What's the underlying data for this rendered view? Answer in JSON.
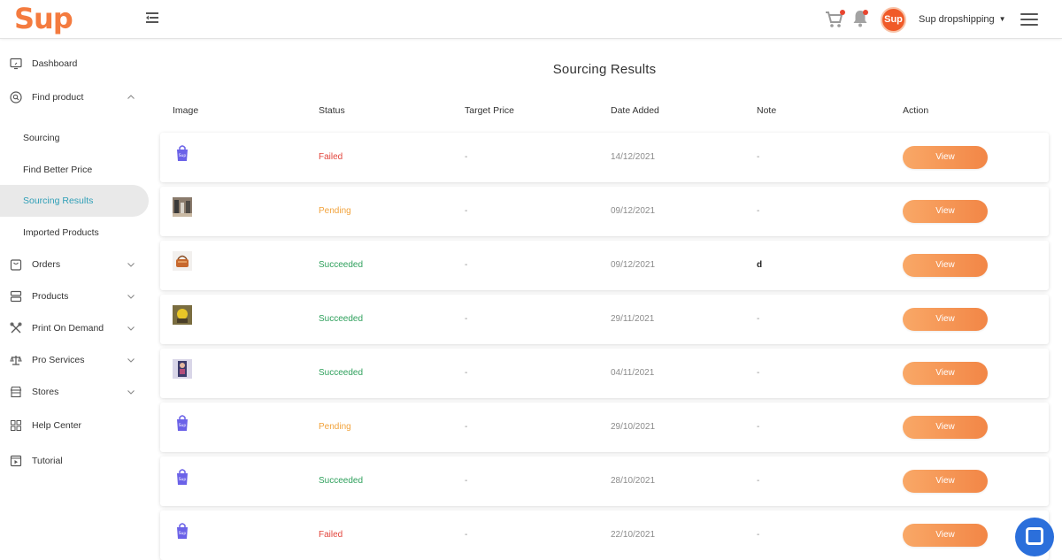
{
  "header": {
    "logo": "Sup",
    "avatar_text": "Sup",
    "account_name": "Sup dropshipping"
  },
  "sidebar": {
    "items": [
      {
        "label": "Dashboard",
        "icon": "monitor-icon"
      },
      {
        "label": "Find product",
        "icon": "search-circle-icon",
        "expanded": true
      },
      {
        "label": "Orders",
        "icon": "bag-icon"
      },
      {
        "label": "Products",
        "icon": "stack-icon"
      },
      {
        "label": "Print On Demand",
        "icon": "tools-icon"
      },
      {
        "label": "Pro Services",
        "icon": "scale-icon"
      },
      {
        "label": "Stores",
        "icon": "store-icon"
      },
      {
        "label": "Help Center",
        "icon": "grid-icon"
      },
      {
        "label": "Tutorial",
        "icon": "play-icon"
      }
    ],
    "sub_items": [
      {
        "label": "Sourcing"
      },
      {
        "label": "Find Better Price"
      },
      {
        "label": "Sourcing Results",
        "active": true
      },
      {
        "label": "Imported Products"
      }
    ]
  },
  "main": {
    "title": "Sourcing Results",
    "columns": [
      "Image",
      "Status",
      "Target Price",
      "Date Added",
      "Note",
      "Action"
    ],
    "rows": [
      {
        "image": "sup-bag",
        "status": "Failed",
        "target_price": "-",
        "date_added": "14/12/2021",
        "note": "-",
        "action": "View"
      },
      {
        "image": "photo-people",
        "status": "Pending",
        "target_price": "-",
        "date_added": "09/12/2021",
        "note": "-",
        "action": "View"
      },
      {
        "image": "photo-basket",
        "status": "Succeeded",
        "target_price": "-",
        "date_added": "09/12/2021",
        "note": "d",
        "action": "View"
      },
      {
        "image": "photo-yellow",
        "status": "Succeeded",
        "target_price": "-",
        "date_added": "29/11/2021",
        "note": "-",
        "action": "View"
      },
      {
        "image": "photo-figure",
        "status": "Succeeded",
        "target_price": "-",
        "date_added": "04/11/2021",
        "note": "-",
        "action": "View"
      },
      {
        "image": "sup-bag",
        "status": "Pending",
        "target_price": "-",
        "date_added": "29/10/2021",
        "note": "-",
        "action": "View"
      },
      {
        "image": "sup-bag",
        "status": "Succeeded",
        "target_price": "-",
        "date_added": "28/10/2021",
        "note": "-",
        "action": "View"
      },
      {
        "image": "sup-bag",
        "status": "Failed",
        "target_price": "-",
        "date_added": "22/10/2021",
        "note": "-",
        "action": "View"
      }
    ]
  },
  "colors": {
    "brand": "#f47b3f",
    "failed": "#e2453c",
    "pending": "#f2a33c",
    "succeeded": "#2fa05c",
    "active_nav": "#2f9fb7"
  }
}
